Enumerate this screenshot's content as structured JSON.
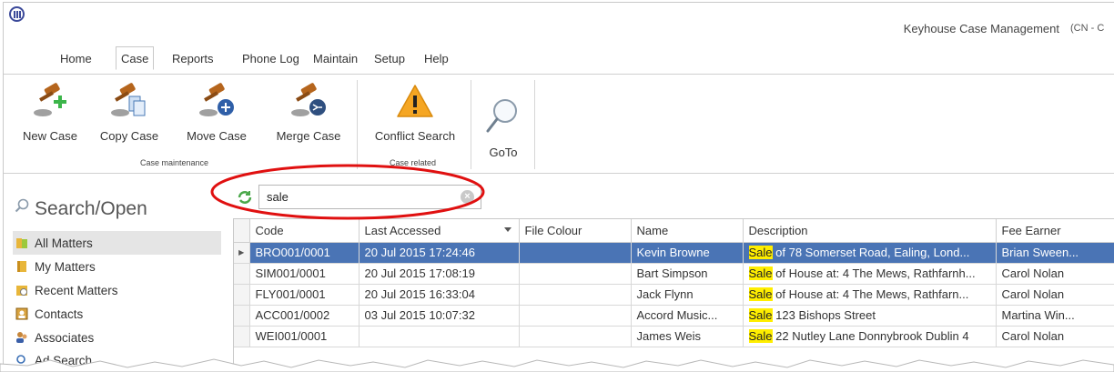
{
  "window": {
    "title": "Keyhouse Case Management",
    "title_extra": "(CN - C"
  },
  "menu": {
    "tabs": [
      {
        "label": "Home"
      },
      {
        "label": "Case"
      },
      {
        "label": "Reports"
      },
      {
        "label": "Phone Log"
      },
      {
        "label": "Maintain"
      },
      {
        "label": "Setup"
      },
      {
        "label": "Help"
      }
    ],
    "active": "Case"
  },
  "ribbon": {
    "buttons": [
      {
        "label": "New Case"
      },
      {
        "label": "Copy Case"
      },
      {
        "label": "Move Case"
      },
      {
        "label": "Merge Case"
      },
      {
        "label": "Conflict Search"
      },
      {
        "label": "GoTo"
      }
    ],
    "groups": [
      {
        "label": "Case maintenance"
      },
      {
        "label": "Case related"
      }
    ]
  },
  "sidebar": {
    "heading": "Search/Open",
    "items": [
      {
        "label": "All Matters"
      },
      {
        "label": "My Matters"
      },
      {
        "label": "Recent Matters"
      },
      {
        "label": "Contacts"
      },
      {
        "label": "Associates"
      },
      {
        "label": "Ad    Search"
      }
    ]
  },
  "filter": {
    "value": "sale"
  },
  "grid": {
    "columns": [
      "Code",
      "Last Accessed",
      "File Colour",
      "Name",
      "Description",
      "Fee Earner"
    ],
    "rows": [
      {
        "code": "BRO001/0001",
        "last_accessed": "20 Jul 2015 17:24:46",
        "file_colour": "",
        "name": "Kevin Browne",
        "desc_hl": "Sale",
        "desc_rest": " of 78 Somerset Road, Ealing, Lond...",
        "fee_earner": "Brian Sween..."
      },
      {
        "code": "SIM001/0001",
        "last_accessed": "20 Jul 2015 17:08:19",
        "file_colour": "",
        "name": "Bart Simpson",
        "desc_hl": "Sale",
        "desc_rest": " of House at: 4 The Mews, Rathfarnh...",
        "fee_earner": "Carol Nolan"
      },
      {
        "code": "FLY001/0001",
        "last_accessed": "20 Jul 2015 16:33:04",
        "file_colour": "",
        "name": "Jack Flynn",
        "desc_hl": "Sale",
        "desc_rest": " of House at:  4 The Mews, Rathfarn...",
        "fee_earner": "Carol Nolan"
      },
      {
        "code": "ACC001/0002",
        "last_accessed": "03 Jul 2015 10:07:32",
        "file_colour": "",
        "name": "Accord Music...",
        "desc_hl": "Sale",
        "desc_rest": " 123 Bishops Street",
        "fee_earner": "Martina Win..."
      },
      {
        "code": "WEI001/0001",
        "last_accessed": "",
        "file_colour": "",
        "name": "James Weis",
        "desc_hl": "Sale",
        "desc_rest": " 22 Nutley Lane Donnybrook Dublin 4",
        "fee_earner": "Carol Nolan"
      }
    ]
  },
  "colors": {
    "selected_row": "#4a74b5",
    "highlight": "#ffee00",
    "annotation_ring": "#e01010",
    "gavel_brown": "#b5651d"
  }
}
